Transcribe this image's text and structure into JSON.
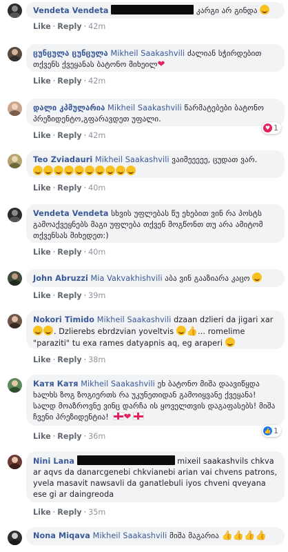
{
  "actions": {
    "like": "Like",
    "reply": "Reply",
    "dot": "·"
  },
  "colors": {
    "author": "#385898",
    "bubble": "#f2f3f5",
    "meta": "#606770",
    "love": "#e0245e",
    "like_reaction": "#1877f2"
  },
  "comments": [
    {
      "author": "Vendeta Vendeta",
      "text_after": " კარგი არ გინდა",
      "time": "42m"
    },
    {
      "author": "ცუნცულა ცუნცულა",
      "mention": "Mikheil Saakashvili",
      "text": " ძალიან სჭირდებით თქვენს ქვეყანას ბატონო მიხეილ",
      "time": "42m"
    },
    {
      "author": "დალი კპმულარია",
      "mention": "Mikheil Saakashvili",
      "text": " წარმატებები ბატონო პრეზიდენტო,გფარავდეთ უფალი.",
      "time": "42m",
      "reaction_count": "1",
      "reaction_icon": "love-reaction-icon"
    },
    {
      "author": "Teo Zviadauri",
      "mention": "Mikheil Saakashvili",
      "text": " ვაიმეეეეე, ცუდათ ვარ.",
      "time": "40m"
    },
    {
      "author": "Vendeta Vendeta",
      "text": " სხვის უფლებას წუ ეხებით ვინ რა პოსტს გამოაქვეყნებს მაგი უფლება თქვენ მოგწონთ თუ არა ამიტომ თქვენსას მიხედეთ:)",
      "time": "40m"
    },
    {
      "author": "John Abruzzi",
      "mention": "Mia Vakvakhishvili",
      "text": " აბა ვინ გააზიარა კაცო",
      "time": "39m"
    },
    {
      "author": "Nokori Timido",
      "mention": "Mikheil Saakashvili",
      "text_1": " dzaan dzlieri da jigari xar",
      "text_2": ". Dzlierebs ebrdzvian yoveltvis",
      "text_3": "... romelime \"paraziti\" tu exa rames datyapnis aq, eg araperi",
      "time": "38m"
    },
    {
      "author": "Катя Катя",
      "mention": "Mikheil Saakashvili",
      "text": " ეხ ბატონო მიშა დაავიწყდა ხალხს ზოგ ზოგიერთს რა უკუნეთიდან გამოიყვანე ქვეყანა! სალდ მოაზროვნე ვინც დარჩა ის ყოველთვის დაგაფასებს! მიშა ჩვენი პრეზიდენტია!",
      "time": "36m",
      "reaction_count": "1",
      "reaction_icon": "like-reaction-icon"
    },
    {
      "author": "Nini Lana",
      "text": " mixeil saakashvils chkva ar aqvs da danarcgenebi chkvianebi arian vai chvens patrons, yvela masavit nawsavli da ganatlebuli iyos chveni qveyana ese gi ar daingreoda",
      "time": "35m"
    },
    {
      "author": "Nona Miqava",
      "mention": "Mikheil Saakashvili",
      "text": " მიშა მაგარია",
      "time": "35m"
    }
  ]
}
